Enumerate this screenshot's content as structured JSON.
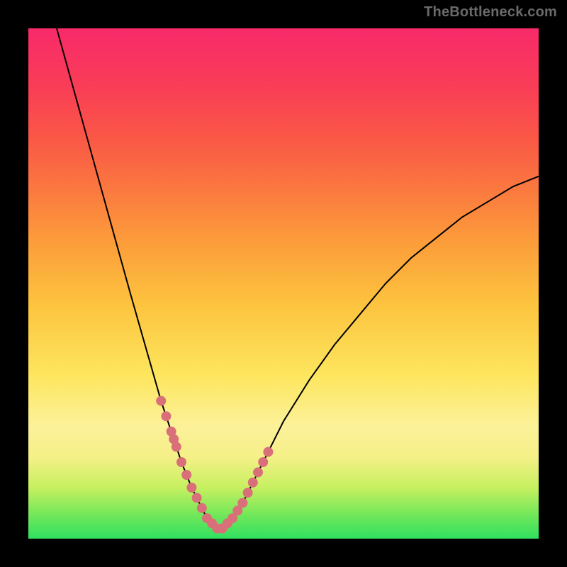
{
  "watermark": "TheBottleneck.com",
  "colors": {
    "frame": "#000000",
    "marker": "#d97079",
    "curve": "#000000",
    "gradient_top": "#f82a6a",
    "gradient_bottom": "#30e060"
  },
  "chart_data": {
    "type": "line",
    "title": "",
    "xlabel": "",
    "ylabel": "",
    "xlim": [
      0,
      100
    ],
    "ylim": [
      0,
      100
    ],
    "x": [
      0,
      5,
      10,
      15,
      20,
      22,
      24,
      26,
      28,
      30,
      32,
      34,
      35,
      36,
      37,
      38,
      40,
      42,
      44,
      46,
      48,
      50,
      55,
      60,
      65,
      70,
      75,
      80,
      85,
      90,
      95,
      100
    ],
    "values": [
      120,
      102,
      84,
      66,
      48,
      41,
      34,
      27,
      21,
      15,
      10,
      6,
      4,
      3,
      2,
      2,
      4,
      7,
      11,
      15,
      19,
      23,
      31,
      38,
      44,
      50,
      55,
      59,
      63,
      66,
      69,
      71
    ],
    "markers_x": [
      26,
      27,
      28,
      28.5,
      29,
      30,
      31,
      32,
      33,
      34,
      35,
      36,
      37,
      38,
      39,
      40,
      41,
      42,
      43,
      44,
      45,
      46,
      47
    ],
    "markers_y": [
      27,
      24,
      21,
      19.5,
      18,
      15,
      12.5,
      10,
      8,
      6,
      4,
      3,
      2,
      2,
      3,
      4,
      5.5,
      7,
      9,
      11,
      13,
      15,
      17
    ]
  }
}
